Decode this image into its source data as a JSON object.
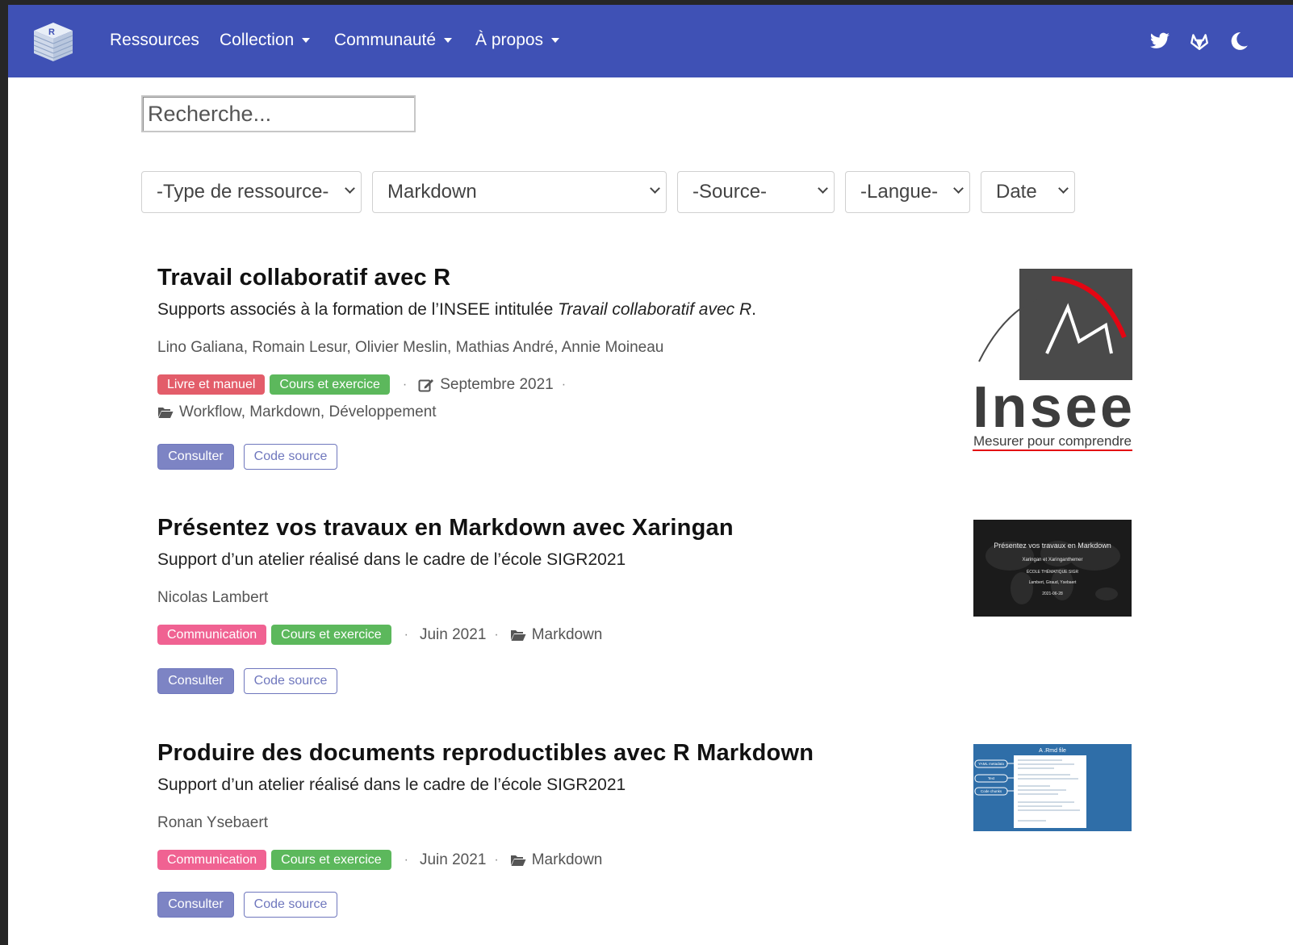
{
  "colors": {
    "navbar": "#3f51b5",
    "tag_livre": "#e35d6a",
    "tag_cours": "#5cb85c",
    "tag_communication": "#f06292",
    "button_primary": "#7d84c4"
  },
  "navbar": {
    "logo_icon": "book-stack-icon",
    "items": [
      {
        "label": "Ressources",
        "has_dropdown": false
      },
      {
        "label": "Collection",
        "has_dropdown": true
      },
      {
        "label": "Communauté",
        "has_dropdown": true
      },
      {
        "label": "À propos",
        "has_dropdown": true
      }
    ],
    "right_icons": [
      "twitter-icon",
      "gitlab-icon",
      "dark-mode-icon"
    ]
  },
  "search": {
    "placeholder": "Recherche...",
    "value": ""
  },
  "filters": [
    {
      "name": "type",
      "selected": "-Type de ressource-"
    },
    {
      "name": "tag",
      "selected": "Markdown"
    },
    {
      "name": "source",
      "selected": "-Source-"
    },
    {
      "name": "langue",
      "selected": "-Langue-"
    },
    {
      "name": "sort",
      "selected": "Date"
    }
  ],
  "items": [
    {
      "title": "Travail collaboratif avec R",
      "subtitle_prefix": "Supports associés à la formation de l’INSEE intitulée ",
      "subtitle_italic": "Travail collaboratif avec R",
      "subtitle_suffix": ".",
      "authors": "Lino Galiana, Romain Lesur, Olivier Meslin, Mathias André, Annie Moineau",
      "tags": [
        "Livre et manuel",
        "Cours et exercice"
      ],
      "date": "Septembre 2021",
      "date_icon": "edit-icon",
      "topics": "Workflow, Markdown, Développement",
      "topics_icon": "folder-open-icon",
      "buttons": {
        "consult": "Consulter",
        "source": "Code source"
      },
      "thumbnail": {
        "word": "Insee",
        "tagline": "Mesurer pour comprendre"
      }
    },
    {
      "title": "Présentez vos travaux en Markdown avec Xaringan",
      "subtitle": "Support d’un atelier réalisé dans le cadre de l’école SIGR2021",
      "authors": "Nicolas Lambert",
      "tags": [
        "Communication",
        "Cours et exercice"
      ],
      "date": "Juin 2021",
      "topics": "Markdown",
      "topics_icon": "folder-open-icon",
      "buttons": {
        "consult": "Consulter",
        "source": "Code source"
      },
      "thumbnail": {
        "lines": [
          "Présentez vos travaux en Markdown",
          "Xaringan et Xaringanthemer",
          "ÉCOLE THÉMATIQUE SIGR",
          "Lambert, Giraud, Ysebaert",
          "2021-06-28"
        ]
      }
    },
    {
      "title": "Produire des documents reproductibles avec R Markdown",
      "subtitle": "Support d’un atelier réalisé dans le cadre de l’école SIGR2021",
      "authors": "Ronan Ysebaert",
      "tags": [
        "Communication",
        "Cours et exercice"
      ],
      "date": "Juin 2021",
      "topics": "Markdown",
      "topics_icon": "folder-open-icon",
      "buttons": {
        "consult": "Consulter",
        "source": "Code source"
      },
      "thumbnail": {
        "title": "A .Rmd file",
        "labels": [
          "YAML metadata",
          "Text",
          "Code chunks"
        ]
      }
    }
  ]
}
